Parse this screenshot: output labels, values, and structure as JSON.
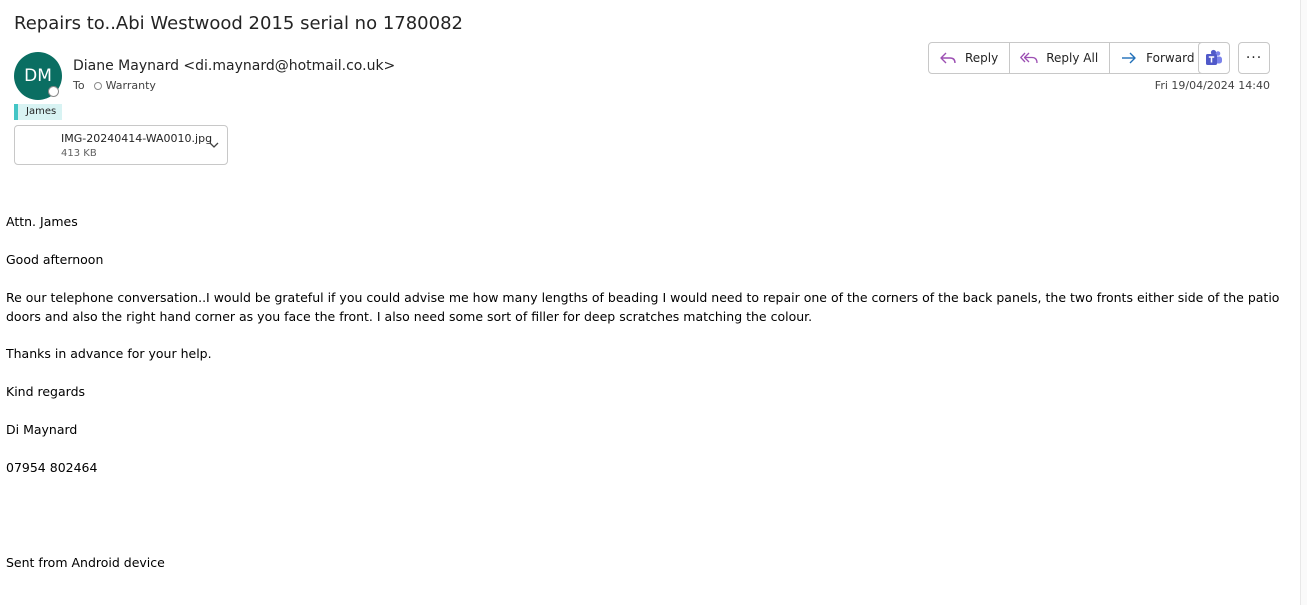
{
  "message": {
    "subject": "Repairs to..Abi Westwood 2015 serial no 1780082",
    "avatar_initials": "DM",
    "sender": "Diane Maynard <di.maynard@hotmail.co.uk>",
    "to_label": "To",
    "recipient": "Warranty",
    "category": "James",
    "date": "Fri 19/04/2024 14:40"
  },
  "attachment": {
    "name": "IMG-20240414-WA0010.jpg",
    "size": "413 KB"
  },
  "actions": {
    "reply": "Reply",
    "reply_all": "Reply All",
    "forward": "Forward",
    "more": "···"
  },
  "body": {
    "greeting_attn": "Attn. James",
    "greeting": "Good afternoon",
    "paragraph": "Re our telephone conversation..I would be grateful if you could advise me how many lengths of beading I would need to repair one of the corners of the back panels, the two fronts either side of the patio doors and also the right hand corner as you face the front. I also need some sort of filler for deep scratches matching the colour.",
    "thanks": "Thanks in advance for your help.",
    "signoff": "Kind regards",
    "name": "Di Maynard",
    "phone": "07954 802464",
    "footer": "Sent from Android device"
  },
  "colors": {
    "avatar": "#0a6e62",
    "category_bar": "#43c5c5",
    "category_bg": "#d8f3f3",
    "reply_icon": "#9c4fb3",
    "forward_icon": "#1f6fb8",
    "teams_icon": "#5059c9"
  }
}
